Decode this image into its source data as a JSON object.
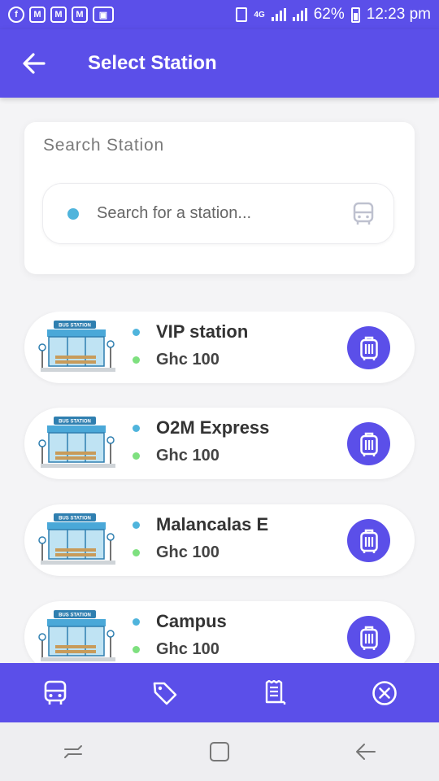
{
  "status_bar": {
    "left_icons": [
      "facebook-icon",
      "gmail-icon",
      "gmail-icon",
      "gmail-icon",
      "photo-icon"
    ],
    "network": "4G",
    "battery": "62%",
    "time": "12:23 pm"
  },
  "app_bar": {
    "title": "Select Station",
    "back_icon": "arrow-left-icon"
  },
  "search": {
    "title": "Search Station",
    "placeholder": "Search for a station...",
    "value": "",
    "trailing_icon": "bus-icon"
  },
  "stations": [
    {
      "name": "VIP station",
      "price": "Ghc 100",
      "image_label": "BUS STATION"
    },
    {
      "name": "O2M Express",
      "price": "Ghc 100",
      "image_label": "BUS STATION"
    },
    {
      "name": "Malancalas E",
      "price": "Ghc 100",
      "image_label": "BUS STATION"
    },
    {
      "name": "Campus",
      "price": "Ghc 100",
      "image_label": "BUS STATION"
    }
  ],
  "tab_bar": {
    "tabs": [
      {
        "icon": "bus-icon"
      },
      {
        "icon": "tag-icon"
      },
      {
        "icon": "receipt-icon"
      },
      {
        "icon": "close-circle-icon"
      }
    ]
  },
  "colors": {
    "primary": "#5b4fe9",
    "accent_blue_dot": "#4fb4dc",
    "accent_green_dot": "#7ee07f",
    "background": "#f4f4f6"
  }
}
